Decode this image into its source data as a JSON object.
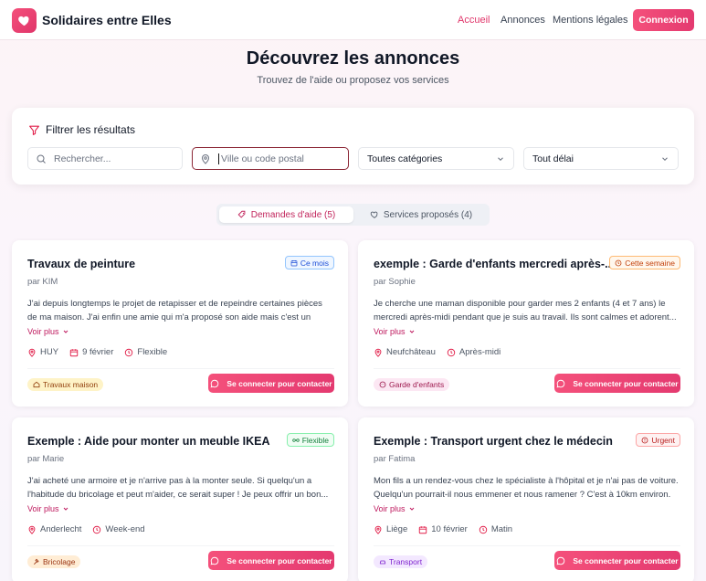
{
  "header": {
    "brand": "Solidaires entre Elles",
    "nav": [
      "Accueil",
      "Annonces",
      "Mentions légales"
    ],
    "login": "Connexion"
  },
  "hero": {
    "title": "Découvrez les annonces",
    "subtitle": "Trouvez de l'aide ou proposez vos services"
  },
  "filters": {
    "title": "Filtrer les résultats",
    "search_placeholder": "Rechercher...",
    "city_placeholder": "Ville ou code postal",
    "category": "Toutes catégories",
    "delay": "Tout délai"
  },
  "tabs": {
    "requests": "Demandes d'aide (5)",
    "services": "Services proposés (4)"
  },
  "common": {
    "see_more": "Voir plus",
    "contact": "Se connecter pour contacter"
  },
  "cards": [
    {
      "title": "Travaux de peinture",
      "author": "par KIM",
      "desc": "J'ai depuis longtemps le projet de retapisser et de repeindre certaines pièces de ma maison. J'ai enfin une amie qui m'a proposé son aide mais c'est un travail de...",
      "badge": "Ce mois",
      "location": "HUY",
      "date": "9 février",
      "time": "Flexible",
      "tag": "Travaux maison"
    },
    {
      "title": "exemple : Garde d'enfants mercredi après-...",
      "author": "par Sophie",
      "desc": "Je cherche une maman disponible pour garder mes 2 enfants (4 et 7 ans) le mercredi après-midi pendant que je suis au travail. Ils sont calmes et adorent...",
      "badge": "Cette semaine",
      "location": "Neufchâteau",
      "time": "Après-midi",
      "tag": "Garde d'enfants"
    },
    {
      "title": "Exemple : Aide pour monter un meuble IKEA",
      "author": "par Marie",
      "desc": "J'ai acheté une armoire et je n'arrive pas à la monter seule. Si quelqu'un a l'habitude du bricolage et peut m'aider, ce serait super ! Je peux offrir un bon...",
      "badge": "Flexible",
      "location": "Anderlecht",
      "time": "Week-end",
      "tag": "Bricolage"
    },
    {
      "title": "Exemple : Transport urgent chez le médecin",
      "author": "par Fatima",
      "desc": "Mon fils a un rendez-vous chez le spécialiste à l'hôpital et je n'ai pas de voiture. Quelqu'un pourrait-il nous emmener et nous ramener ? C'est à 10km environ.",
      "badge": "Urgent",
      "location": "Liège",
      "date": "10 février",
      "time": "Matin",
      "tag": "Transport"
    }
  ],
  "colors": {
    "accent": "#e43a70",
    "accent_light": "#f4507b"
  }
}
